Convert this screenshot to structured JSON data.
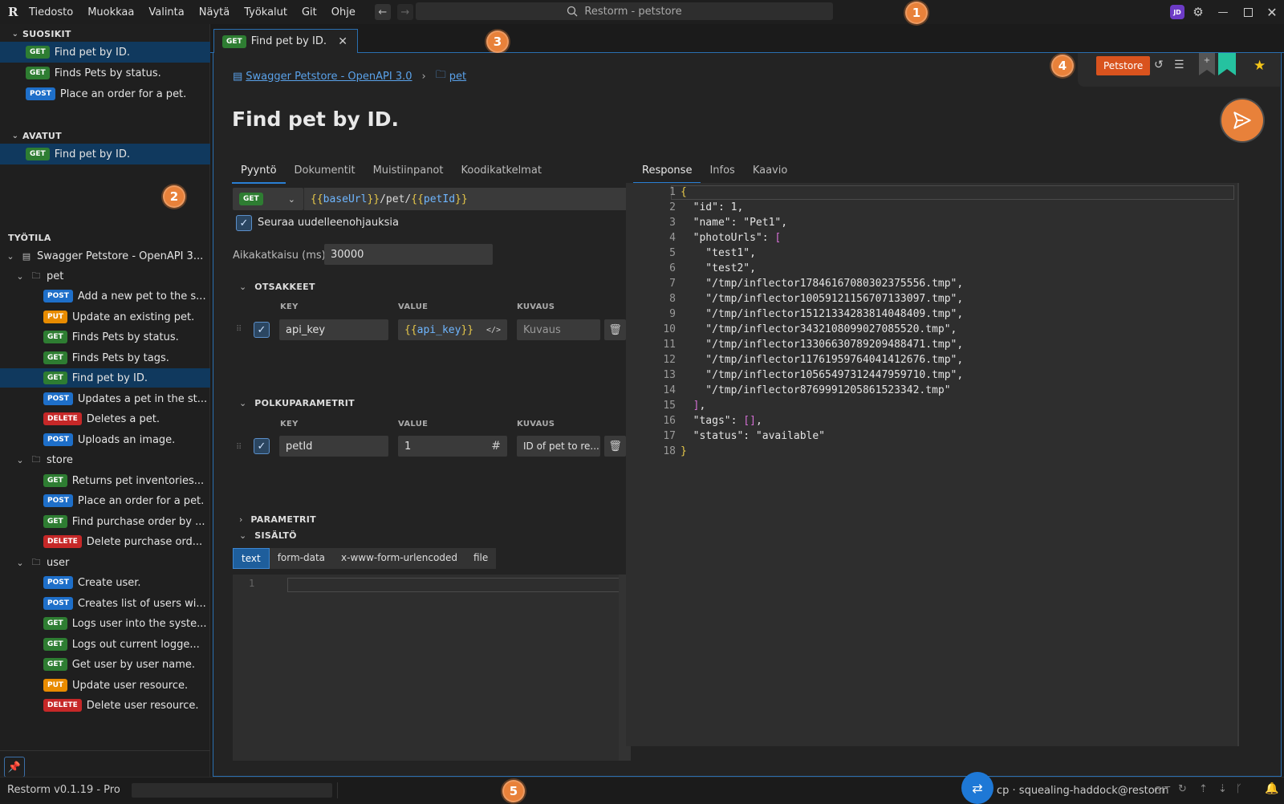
{
  "titlebar": {
    "logo": "R",
    "menu": [
      "Tiedosto",
      "Muokkaa",
      "Valinta",
      "Näytä",
      "Työkalut",
      "Git",
      "Ohje"
    ],
    "search_text": "Restorm - petstore",
    "avatar_initials": "JD"
  },
  "markers": [
    "1",
    "2",
    "3",
    "4",
    "5"
  ],
  "sidebar": {
    "favorites_header": "SUOSIKIT",
    "favorites": [
      {
        "method": "GET",
        "label": "Find pet by ID."
      },
      {
        "method": "GET",
        "label": "Finds Pets by status."
      },
      {
        "method": "POST",
        "label": "Place an order for a pet."
      }
    ],
    "open_header": "AVATUT",
    "open": [
      {
        "method": "GET",
        "label": "Find pet by ID."
      }
    ],
    "workspace_header": "TYÖTILA",
    "workspace_root": "Swagger Petstore - OpenAPI 3...",
    "folders": [
      {
        "name": "pet",
        "items": [
          {
            "method": "POST",
            "label": "Add a new pet to the s..."
          },
          {
            "method": "PUT",
            "label": "Update an existing pet."
          },
          {
            "method": "GET",
            "label": "Finds Pets by status."
          },
          {
            "method": "GET",
            "label": "Finds Pets by tags."
          },
          {
            "method": "GET",
            "label": "Find pet by ID."
          },
          {
            "method": "POST",
            "label": "Updates a pet in the st..."
          },
          {
            "method": "DELETE",
            "label": "Deletes a pet."
          },
          {
            "method": "POST",
            "label": "Uploads an image."
          }
        ]
      },
      {
        "name": "store",
        "items": [
          {
            "method": "GET",
            "label": "Returns pet inventories..."
          },
          {
            "method": "POST",
            "label": "Place an order for a pet."
          },
          {
            "method": "GET",
            "label": "Find purchase order by ..."
          },
          {
            "method": "DELETE",
            "label": "Delete purchase ord..."
          }
        ]
      },
      {
        "name": "user",
        "items": [
          {
            "method": "POST",
            "label": "Create user."
          },
          {
            "method": "POST",
            "label": "Creates list of users wi..."
          },
          {
            "method": "GET",
            "label": "Logs user into the syste..."
          },
          {
            "method": "GET",
            "label": "Logs out current logge..."
          },
          {
            "method": "GET",
            "label": "Get user by user name."
          },
          {
            "method": "PUT",
            "label": "Update user resource."
          },
          {
            "method": "DELETE",
            "label": "Delete user resource."
          }
        ]
      }
    ]
  },
  "tab": {
    "method": "GET",
    "label": "Find pet by ID."
  },
  "breadcrumb": {
    "collection": "Swagger Petstore - OpenAPI 3.0",
    "folder": "pet"
  },
  "environment": "Petstore",
  "request_title": "Find pet by ID.",
  "request_tabs": [
    "Pyyntö",
    "Dokumentit",
    "Muistiinpanot",
    "Koodikatkelmat"
  ],
  "response_tabs": [
    "Response",
    "Infos",
    "Kaavio"
  ],
  "url": {
    "method": "GET",
    "open": "{{",
    "var1": "baseUrl",
    "close": "}}",
    "path": "/pet/",
    "var2": "petId"
  },
  "follow_redirects": "Seuraa uudelleenohjauksia",
  "timeout": {
    "label": "Aikakatkaisu (ms)",
    "value": "30000"
  },
  "headers": {
    "title": "OTSAKKEET",
    "col_key": "KEY",
    "col_value": "VALUE",
    "col_desc": "KUVAUS",
    "row": {
      "key": "api_key",
      "value": "api_key",
      "desc_placeholder": "Kuvaus"
    }
  },
  "path_params": {
    "title": "POLKUPARAMETRIT",
    "col_key": "KEY",
    "col_value": "VALUE",
    "col_desc": "KUVAUS",
    "row": {
      "key": "petId",
      "value": "1",
      "desc": "ID of pet to re..."
    }
  },
  "params_title": "PARAMETRIT",
  "body": {
    "title": "SISÄLTÖ",
    "types": [
      "text",
      "form-data",
      "x-www-form-urlencoded",
      "file"
    ],
    "line": "1"
  },
  "response_lines": [
    "{",
    "  \"id\": 1,",
    "  \"name\": \"Pet1\",",
    "  \"photoUrls\": [",
    "    \"test1\",",
    "    \"test2\",",
    "    \"/tmp/inflector17846167080302375556.tmp\",",
    "    \"/tmp/inflector10059121156707133097.tmp\",",
    "    \"/tmp/inflector15121334283814048409.tmp\",",
    "    \"/tmp/inflector3432108099027085520.tmp\",",
    "    \"/tmp/inflector13306630789209488471.tmp\",",
    "    \"/tmp/inflector11761959764041412676.tmp\",",
    "    \"/tmp/inflector10565497312447959710.tmp\",",
    "    \"/tmp/inflector8769991205861523342.tmp\"",
    "  ],",
    "  \"tags\": [],",
    "  \"status\": \"available\"",
    "}"
  ],
  "statusbar": {
    "version": "Restorm v0.1.19 - Pro",
    "user": "cp · squealing-haddock@restorm",
    "git": "GIT"
  },
  "colors": {
    "accent": "#2a7fd4",
    "send": "#e8813a",
    "env": "#d9531e",
    "bookmark": "#25c2a0",
    "star": "#f5c518"
  }
}
